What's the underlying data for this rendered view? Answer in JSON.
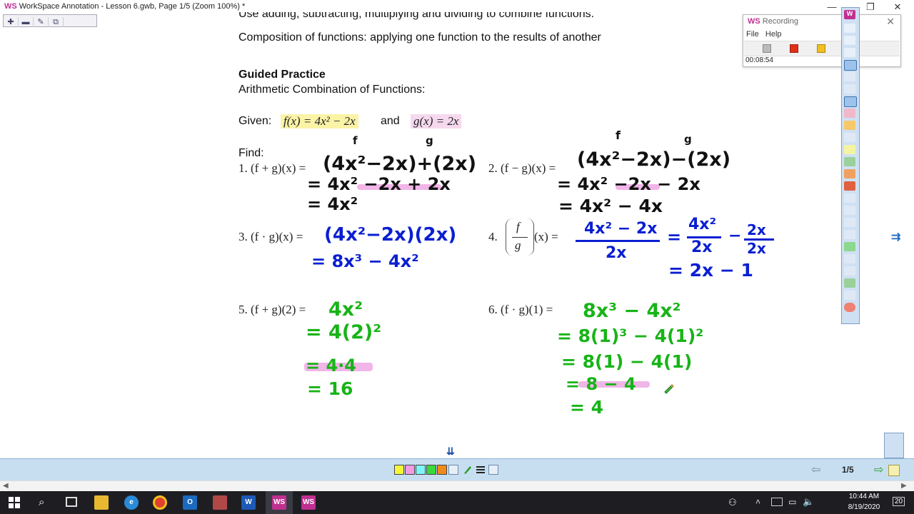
{
  "window": {
    "title": "WorkSpace Annotation - Lesson 6.gwb, Page 1/5  (Zoom 100%) *",
    "app_badge": "WS",
    "controls": [
      "—",
      "❐",
      "✕"
    ]
  },
  "lesson": {
    "line_partial": "Use adding, subtracting, multiplying and dividing to combine functions.",
    "composition": "Composition of functions: applying one function to the results of another",
    "guided_heading": "Guided Practice",
    "subheading": "Arithmetic Combination of Functions:",
    "given_label": "Given:",
    "given_f": "f(x) = 4x² − 2x",
    "and_label": "and",
    "given_g": "g(x) = 2x",
    "find_label": "Find:",
    "problems": {
      "p1": "1.  (f + g)(x) =",
      "p2": "2.  (f − g)(x) =",
      "p3": "3.   (f · g)(x) =",
      "p4_num": "4.",
      "p4_f": "f",
      "p4_g": "g",
      "p4_x": "(x) =",
      "p5": "5. (f + g)(2) =",
      "p6": "6. (f · g)(1) ="
    }
  },
  "annotations": {
    "p1": {
      "f": "f",
      "g": "g",
      "l1": "(4x²−2x)+(2x)",
      "l2": "= 4x² −2x + 2x",
      "l3": "= 4x²"
    },
    "p2": {
      "f": "f",
      "g": "g",
      "l1": "(4x²−2x)−(2x)",
      "l2": "= 4x² −2x − 2x",
      "l3": "= 4x² − 4x"
    },
    "p3": {
      "l1": "(4x²−2x)(2x)",
      "l2": "= 8x³ − 4x²"
    },
    "p4": {
      "num": "4x² − 2x",
      "den": "2x",
      "eq1": "=",
      "t1n": "4x²",
      "t1d": "2x",
      "minus": "−",
      "t2n": "2x",
      "t2d": "2x",
      "l2": "= 2x − 1"
    },
    "p5": {
      "l1": "4x²",
      "l2": "= 4(2)²",
      "l3": "= 4·4",
      "l4": "= 16"
    },
    "p6": {
      "l1": "8x³ − 4x²",
      "l2": "= 8(1)³ − 4(1)²",
      "l3": "= 8(1) − 4(1)",
      "l4": "= 8 − 4",
      "l5": "= 4"
    }
  },
  "recording": {
    "badge": "WS",
    "title": "Recording",
    "close": "✕",
    "menu_file": "File",
    "menu_help": "Help",
    "time": "00:08:54"
  },
  "pager": {
    "page": "1/5",
    "prev_arrow": "⇦",
    "next_arrow": "⇨",
    "scroll_down": "⇊",
    "side_arrow": "⇉",
    "swatch_colors": [
      "#f5f53a",
      "#f39be0",
      "#7ff5f5",
      "#39d939",
      "#f08a1a"
    ]
  },
  "taskbar": {
    "time": "10:44 AM",
    "date": "8/19/2020",
    "notif_count": "20",
    "app_labels": [
      "W",
      "WS",
      "WS"
    ]
  },
  "colors": {
    "ink_black": "#111111",
    "ink_blue": "#0a1fd2",
    "ink_green": "#17b417",
    "highlight_pink": "#f0a8e4",
    "highlight_yellow": "#fbf3a6"
  }
}
